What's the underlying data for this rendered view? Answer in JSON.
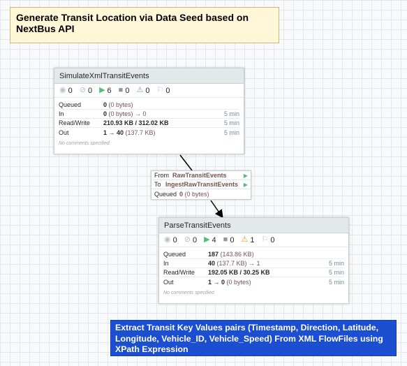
{
  "labels": {
    "top": "Generate Transit Location via Data Seed based on NextBus API",
    "bottom": "Extract Transit Key Values pairs (Timestamp, Direction, Latitude, Longitude, Vehicle_ID, Vehicle_Speed) From XML FlowFiles using XPath Expression"
  },
  "processor1": {
    "name": "SimulateXmlTransitEvents",
    "stats": {
      "invalid": "0",
      "stopped": "0",
      "running": "6",
      "disabled": "0",
      "warnings": "0",
      "threads": "0"
    },
    "rows": [
      {
        "key": "Queued",
        "main": "0",
        "soft": " (0 bytes)",
        "time": ""
      },
      {
        "key": "In",
        "main": "0",
        "soft": " (0 bytes) → 0",
        "time": "5 min"
      },
      {
        "key": "Read/Write",
        "main": "210.93 KB / 312.02 KB",
        "soft": "",
        "time": "5 min"
      },
      {
        "key": "Out",
        "main": "1 → 40",
        "soft": " (137.7 KB)",
        "time": "5 min"
      }
    ],
    "comments": "No comments specified"
  },
  "connection": {
    "from_label": "From",
    "from": "RawTransitEvents",
    "to_label": "To",
    "to": "IngestRawTransitEvents",
    "queued_label": "Queued",
    "queued": "0",
    "queued_soft": " (0 bytes)"
  },
  "processor2": {
    "name": "ParseTransitEvents",
    "stats": {
      "invalid": "0",
      "stopped": "0",
      "running": "4",
      "disabled": "0",
      "warnings": "1",
      "threads": "0"
    },
    "rows": [
      {
        "key": "Queued",
        "main": "187",
        "soft": " (143.86 KB)",
        "time": ""
      },
      {
        "key": "In",
        "main": "40",
        "soft": " (137.7 KB) → 1",
        "time": "5 min"
      },
      {
        "key": "Read/Write",
        "main": "192.05 KB / 30.25 KB",
        "soft": "",
        "time": "5 min"
      },
      {
        "key": "Out",
        "main": "1 → 0",
        "soft": " (0 bytes)",
        "time": "5 min"
      }
    ],
    "comments": "No comments specified"
  },
  "icons": {
    "invalid": "invalid-icon",
    "stopped": "stopped-icon",
    "running": "running-icon",
    "disabled": "disabled-icon",
    "warning": "warning-icon",
    "threads": "threads-icon"
  },
  "colors": {
    "canvas": "#f9fafb",
    "grid": "#e4e8eb",
    "label_yellow": "#fff7d7",
    "label_blue": "#1b4ed0",
    "running_green": "#52bf7e",
    "warning_amber": "#e89b2a",
    "value_brown": "#775351",
    "time_blue": "#728e9b"
  }
}
